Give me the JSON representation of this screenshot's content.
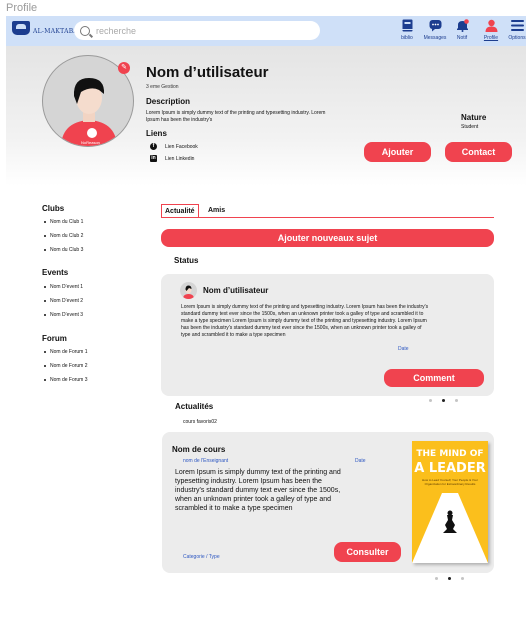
{
  "frame_label": "Profile",
  "header": {
    "logo_text": "AL-MAKTABA",
    "search_placeholder": "recherche",
    "nav": [
      {
        "label": "biblio",
        "icon": "book-icon"
      },
      {
        "label": "Messages",
        "icon": "chat-icon"
      },
      {
        "label": "Notif",
        "icon": "bell-icon",
        "badge": "2"
      },
      {
        "label": "Profile",
        "icon": "user-icon",
        "active": true
      },
      {
        "label": "Options",
        "icon": "menu-icon"
      }
    ]
  },
  "profile": {
    "name": "Nom d’utilisateur",
    "subtitle": "3 eme Gestion",
    "description_title": "Description",
    "description": "Lorem Ipsum is simply dummy text of the printing and typesetting industry. Lorem Ipsum has been the industry's",
    "links_title": "Liens",
    "links": [
      {
        "label": "Lien Facebook",
        "icon": "facebook-icon"
      },
      {
        "label": "Lien Linkedin",
        "icon": "linkedin-icon"
      }
    ],
    "nature_title": "Nature",
    "nature_value": "Student",
    "add_button": "Ajouter",
    "contact_button": "Contact",
    "shirt_text": "NoReason"
  },
  "sidebar": {
    "clubs_title": "Clubs",
    "clubs": [
      "Nom du Club 1",
      "Nom du Club 2",
      "Nom du Club 3"
    ],
    "events_title": "Events",
    "events": [
      "Nom D’event 1",
      "Nom D’event 2",
      "Nom D’event 3"
    ],
    "forum_title": "Forum",
    "forums": [
      "Nom de Forum 1",
      "Nom de Forum 2",
      "Nom de Forum 3"
    ]
  },
  "tabs": [
    "Actualité",
    "Amis"
  ],
  "add_subject_button": "Ajouter nouveaux sujet",
  "status": {
    "title": "Status",
    "post": {
      "user": "Nom d’utilisateur",
      "text": "Lorem Ipsum is simply dummy text of the printing and typesetting industry. Lorem Ipsum has been the industry's standard dummy text ever since the 1500s, when an unknown printer took a galley of type and scrambled it to make a type specimen Lorem Ipsum is simply dummy text of the printing and typesetting industry. Lorem Ipsum has been the industry's standard dummy text ever since the 1500s, when an unknown printer took a galley of type and scrambled it to make a type specimen",
      "date": "Date",
      "comment_button": "Comment"
    },
    "pager_active": 2
  },
  "actualites": {
    "title": "Actualités",
    "subtitle": "cours favoris02",
    "course": {
      "name": "Nom de cours",
      "teacher": "nom de l'Enseignant",
      "date": "Date",
      "text": "Lorem Ipsum is simply dummy text of the printing and typesetting industry. Lorem Ipsum has been the industry's standard dummy text ever since the 1500s, when an unknown printer took a galley of type and scrambled it to make a type specimen",
      "category": "Categorie / Type",
      "button": "Consulter",
      "book": {
        "title_line1": "THE MIND OF",
        "title_line2": "A LEADER",
        "tagline": "How to Lead Yourself, Your People & Your Organization for Extraordinary Results",
        "author_line1": "KEVIN",
        "author_line2": "ANDERSON"
      }
    },
    "pager_active": 2
  },
  "colors": {
    "accent": "#f0434f",
    "header_bg": "#cfe0f8",
    "brand_blue": "#1c3d8f",
    "link_blue": "#2d57c2",
    "card_bg": "#ececec"
  }
}
